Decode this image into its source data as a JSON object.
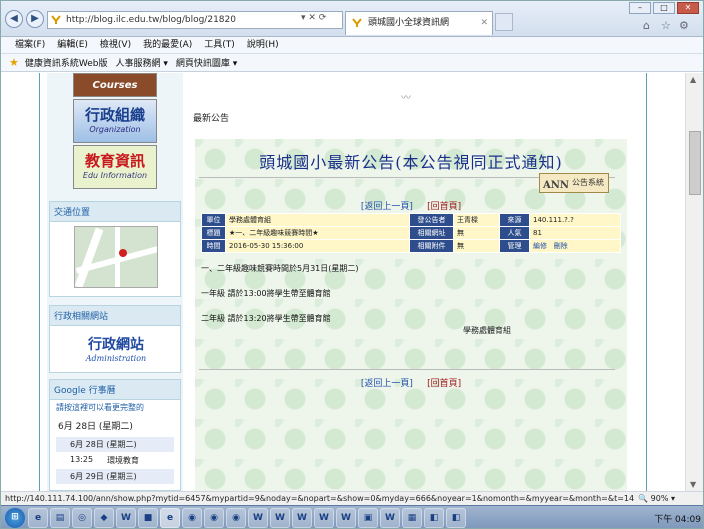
{
  "browser": {
    "url": "http://blog.ilc.edu.tw/blog/blog/21820",
    "tab_title": "頭城國小全球資訊網",
    "menu": [
      "檔案(F)",
      "編輯(E)",
      "檢視(V)",
      "我的最愛(A)",
      "工具(T)",
      "說明(H)"
    ],
    "favorites": [
      "健康資訊系統Web版",
      "人事服務網 ▾",
      "網頁快訊圖庫 ▾"
    ],
    "status_url": "http://140.111.74.100/ann/show.php?mytid=6457&mypartid=9&noday=&nopart=&show=0&myday=666&noyear=1&nomonth=&myyear=&m",
    "status_tail": "onth=&t=146",
    "zoom": "90%"
  },
  "sidebar": {
    "courses_en": "Courses",
    "org_cn": "行政組織",
    "org_en": "Organization",
    "edu_cn": "教育資訊",
    "edu_en": "Edu Information",
    "traffic_title": "交通位置",
    "links_title": "行政相關網站",
    "admin_cn": "行政網站",
    "admin_en": "Administration",
    "gcal_title": "Google 行事曆",
    "gcal_sub": "請按這裡可以看更完整的",
    "gcal_date": "6月 28日 (星期二)",
    "gcal_rows": [
      "6月 28日 (星期二)",
      "6月 29日 (星期三)"
    ],
    "gcal_item_time": "13:25",
    "gcal_item_text": "環境教育"
  },
  "main": {
    "section_label": "最新公告",
    "title": "頭城國小最新公告(本公告視同正式通知)",
    "sys_button": "公告系統",
    "sys_icon": "ANN",
    "nav_back": "[返回上一頁]",
    "nav_home": "[回首頁]",
    "info": {
      "unit_h": "單位",
      "unit_v": "學務處體育組",
      "pub_h": "發公告者",
      "pub_v": "王青樑",
      "src_h": "來源",
      "src_v": "140.111.?.?",
      "subj_h": "標題",
      "subj_v": "★一、二年級趣味競賽時間★",
      "url_h": "相關網址",
      "url_v": "無",
      "count_h": "人氣",
      "count_v": "81",
      "time_h": "時間",
      "time_v": "2016-05-30 15:36:00",
      "att_h": "相關附件",
      "att_v": "無",
      "mgr_h": "管理",
      "edit": "編修",
      "del": "刪除"
    },
    "body": [
      "一、二年級趣味競賽時間於5月31日(星期二)",
      "一年級 請於13:00將學生帶至體育館",
      "二年級 請於13:20將學生帶至體育館"
    ],
    "signer": "學務處體育組"
  },
  "taskbar": {
    "clock": "下午 04:09"
  }
}
